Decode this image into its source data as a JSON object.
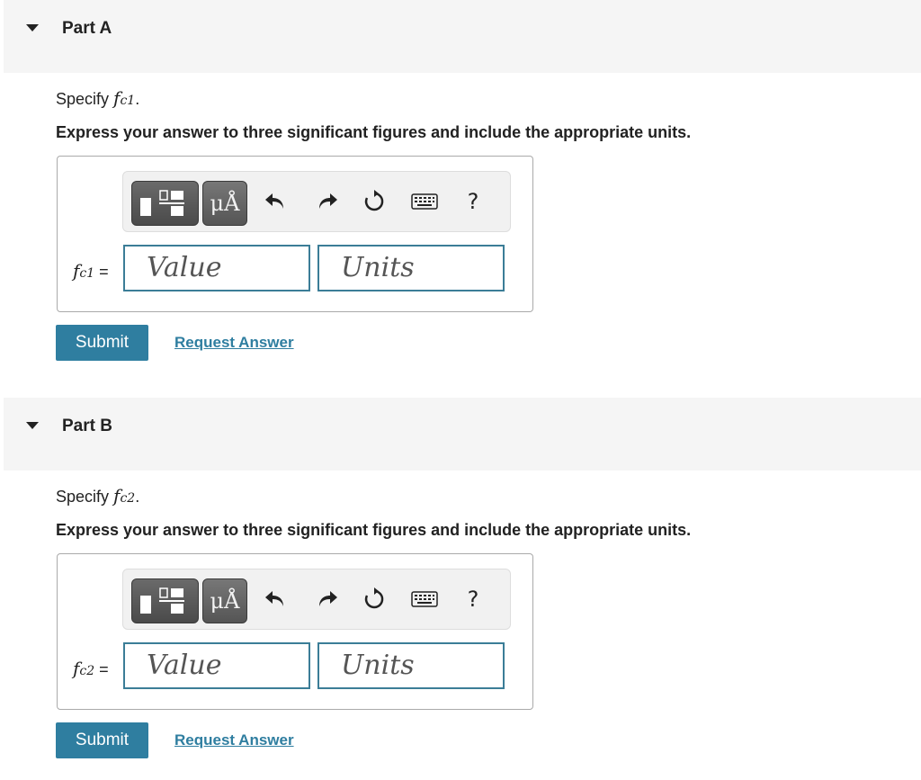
{
  "parts": [
    {
      "title": "Part A",
      "specify_prefix": "Specify ",
      "var_base": "f",
      "var_sub": "c1",
      "specify_suffix": ".",
      "instruction": "Express your answer to three significant figures and include the appropriate units.",
      "label_base": "f",
      "label_sub": "c1",
      "label_eq": " =",
      "value_placeholder": "Value",
      "units_placeholder": "Units",
      "mu_label": "μÅ",
      "help_label": "?",
      "submit_label": "Submit",
      "request_label": "Request Answer"
    },
    {
      "title": "Part B",
      "specify_prefix": "Specify ",
      "var_base": "f",
      "var_sub": "c2",
      "specify_suffix": ".",
      "instruction": "Express your answer to three significant figures and include the appropriate units.",
      "label_base": "f",
      "label_sub": "c2",
      "label_eq": " =",
      "value_placeholder": "Value",
      "units_placeholder": "Units",
      "mu_label": "μÅ",
      "help_label": "?",
      "submit_label": "Submit",
      "request_label": "Request Answer"
    }
  ],
  "colors": {
    "accent": "#2f7ea0",
    "field_border": "#3b7d97",
    "header_bg": "#f5f5f5"
  },
  "icons": [
    "caret-down-icon",
    "templates-icon",
    "units-icon",
    "undo-icon",
    "redo-icon",
    "reset-icon",
    "keyboard-icon",
    "help-icon"
  ]
}
